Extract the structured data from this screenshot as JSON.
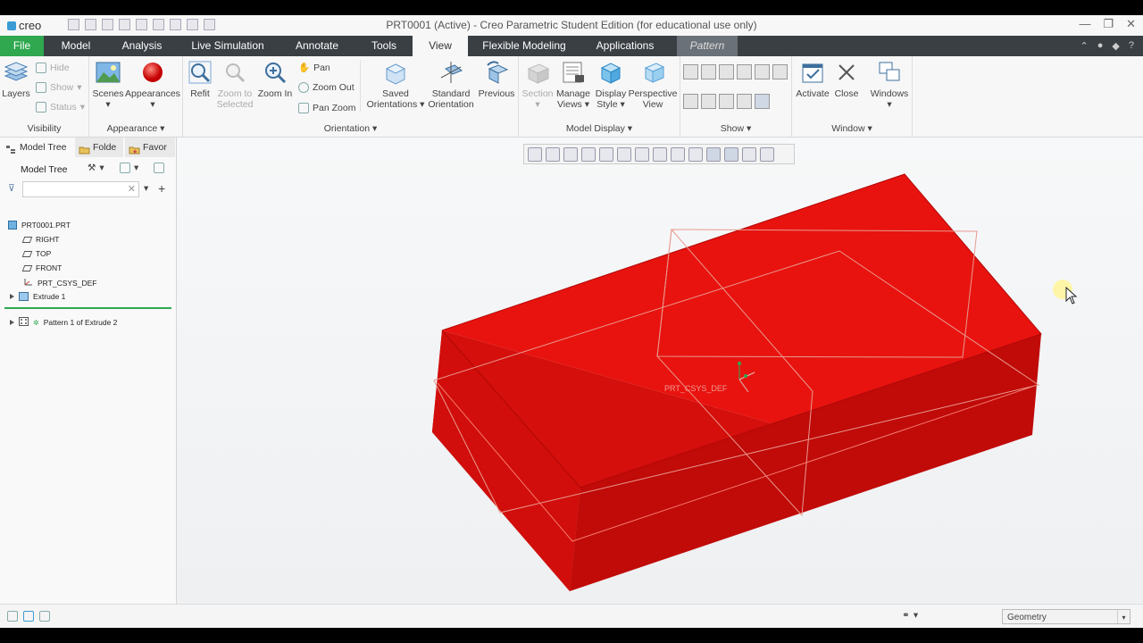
{
  "app": {
    "logo": "creo",
    "title": "PRT0001 (Active) - Creo Parametric Student Edition (for educational use only)"
  },
  "tabs": [
    "File",
    "Model",
    "Analysis",
    "Live Simulation",
    "Annotate",
    "Tools",
    "View",
    "Flexible Modeling",
    "Applications",
    "Pattern"
  ],
  "active_tab": "View",
  "ribbon": {
    "visibility": {
      "layers": "Layers",
      "hide": "Hide",
      "show": "Show",
      "status": "Status",
      "group": "Visibility"
    },
    "appearance": {
      "scenes": "Scenes",
      "appearances": "Appearances",
      "group": "Appearance"
    },
    "orientation": {
      "refit": "Refit",
      "zoom_to_selected_1": "Zoom to",
      "zoom_to_selected_2": "Selected",
      "zoom_in": "Zoom In",
      "pan": "Pan",
      "zoom_out": "Zoom Out",
      "pan_zoom": "Pan Zoom",
      "saved_1": "Saved",
      "saved_2": "Orientations",
      "standard_1": "Standard",
      "standard_2": "Orientation",
      "previous": "Previous",
      "group": "Orientation"
    },
    "model_display": {
      "section": "Section",
      "manage_1": "Manage",
      "manage_2": "Views",
      "display_1": "Display",
      "display_2": "Style",
      "perspective_1": "Perspective",
      "perspective_2": "View",
      "group": "Model Display"
    },
    "show": {
      "group": "Show"
    },
    "window": {
      "activate": "Activate",
      "close": "Close",
      "windows": "Windows",
      "group": "Window"
    }
  },
  "panel": {
    "tabs": [
      "Model Tree",
      "Folde",
      "Favor"
    ],
    "header": "Model Tree",
    "tree": [
      {
        "label": "PRT0001.PRT"
      },
      {
        "label": "RIGHT"
      },
      {
        "label": "TOP"
      },
      {
        "label": "FRONT"
      },
      {
        "label": "PRT_CSYS_DEF"
      },
      {
        "label": "Extrude 1"
      },
      {
        "label": "Pattern 1 of Extrude 2"
      }
    ]
  },
  "viewport": {
    "csys_label": "PRT_CSYS_DEF",
    "model_color": "#e8130f"
  },
  "status": {
    "filter": "Geometry"
  }
}
